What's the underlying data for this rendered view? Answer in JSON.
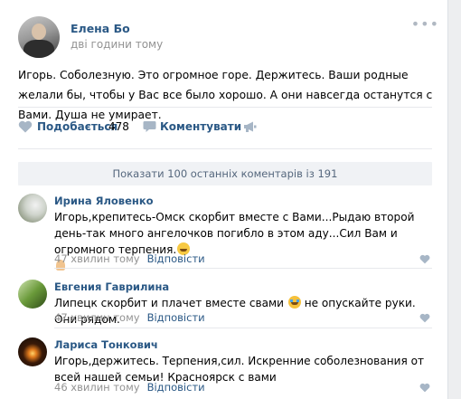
{
  "post": {
    "author": "Елена Бо",
    "time": "дві години тому",
    "text": "Игорь. Соболезную. Это огромное горе. Держитесь. Ваши родные желали бы, чтобы у Вас все было хорошо. А они навсегда останутся с Вами. Душа не умирает.",
    "like_label": "Подобається",
    "like_count": "478",
    "comment_label": "Коментувати"
  },
  "show_more": "Показати 100 останніх коментарів із 191",
  "comments": [
    {
      "author": "Ирина Яловенко",
      "text": "Игорь,крепитесь-Омск скорбит вместе с Вами...Рыдаю второй день-так много ангелочков погибло в этом аду...Сил Вам и огромного терпения.",
      "time": "47 хвилин тому",
      "reply": "Відповісти"
    },
    {
      "author": "Евгения Гаврилина",
      "text_before": "Липецк скорбит и плачет вместе свами",
      "text_after": " не опускайте руки. Они рядом.",
      "time": "47 хвилин тому",
      "reply": "Відповісти"
    },
    {
      "author": "Лариса Тонкович",
      "text": "Игорь,держитесь. Терпения,сил. Искренние соболезнования от всей нашей семьи! Красноярск с вами",
      "time": "46 хвилин тому",
      "reply": "Відповісти"
    }
  ],
  "colors": {
    "link": "#2a5885",
    "meta": "#939393",
    "icon": "#99a9bc"
  }
}
